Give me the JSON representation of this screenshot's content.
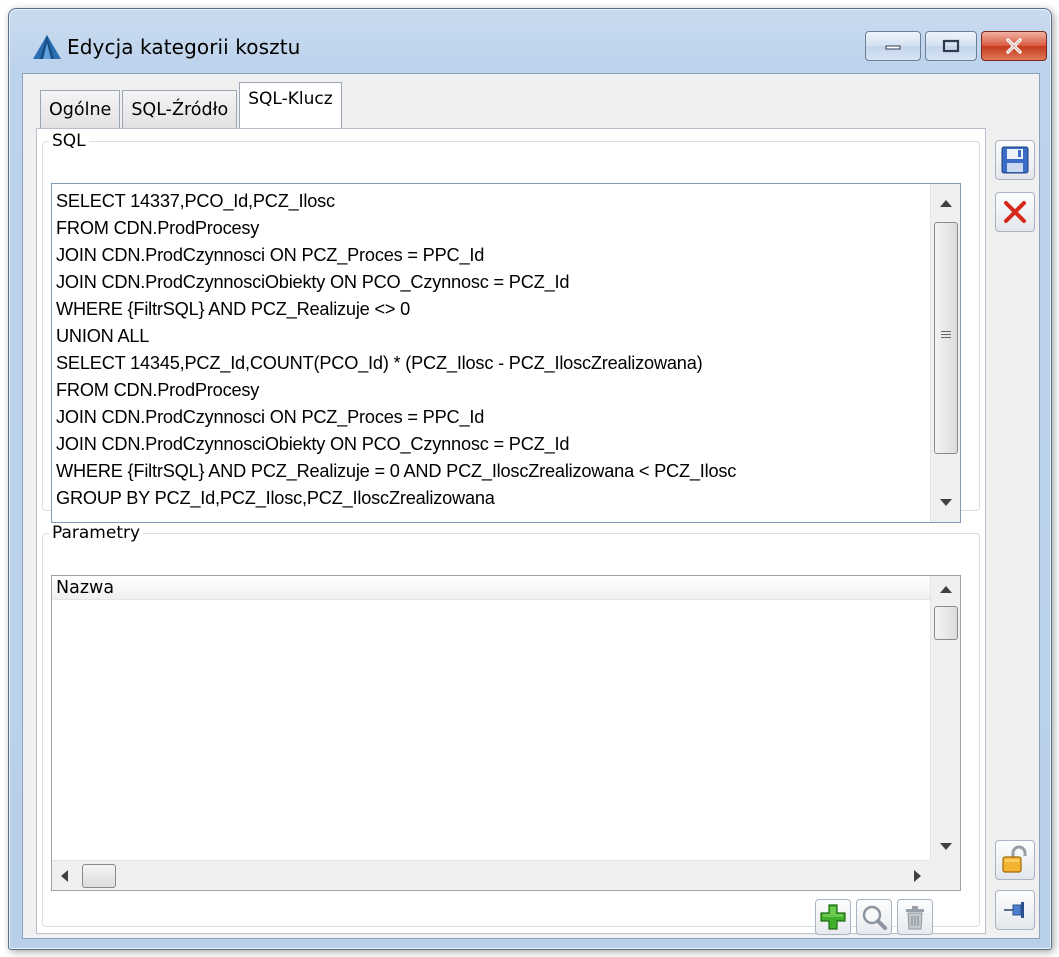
{
  "window": {
    "title": "Edycja kategorii kosztu"
  },
  "tabs": [
    {
      "label": "Ogólne"
    },
    {
      "label": "SQL-Źródło"
    },
    {
      "label": "SQL-Klucz"
    }
  ],
  "active_tab": "SQL-Klucz",
  "sql_group": {
    "legend": "SQL",
    "query": "SELECT 14337,PCO_Id,PCZ_Ilosc\nFROM CDN.ProdProcesy\nJOIN CDN.ProdCzynnosci ON PCZ_Proces = PPC_Id\nJOIN CDN.ProdCzynnosciObiekty ON PCO_Czynnosc = PCZ_Id\nWHERE {FiltrSQL} AND PCZ_Realizuje <> 0\nUNION ALL\nSELECT 14345,PCZ_Id,COUNT(PCO_Id) * (PCZ_Ilosc - PCZ_IloscZrealizowana)\nFROM CDN.ProdProcesy\nJOIN CDN.ProdCzynnosci ON PCZ_Proces = PPC_Id\nJOIN CDN.ProdCzynnosciObiekty ON PCO_Czynnosc = PCZ_Id\nWHERE {FiltrSQL} AND PCZ_Realizuje = 0 AND PCZ_IloscZrealizowana < PCZ_Ilosc\nGROUP BY PCZ_Id,PCZ_Ilosc,PCZ_IloscZrealizowana"
  },
  "params_group": {
    "legend": "Parametry",
    "columns": [
      "Nazwa"
    ],
    "rows": []
  },
  "icons": {
    "app": "app-triangle-icon",
    "save": "floppy-disk-icon",
    "cancel": "red-x-icon",
    "add": "green-plus-icon",
    "search": "magnifier-icon",
    "delete": "trash-icon",
    "lock": "padlock-icon",
    "pin": "pin-icon"
  },
  "colors": {
    "title_bar": "#bdd3ec",
    "close_button": "#c43a1d",
    "add_icon": "#3fae2a",
    "cancel_icon": "#d6281c",
    "save_icon": "#3a6cc8"
  }
}
